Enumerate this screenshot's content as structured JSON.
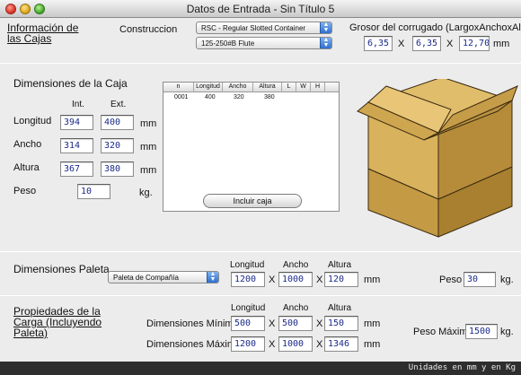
{
  "window": {
    "title": "Datos de Entrada - Sin Título 5"
  },
  "info": {
    "header_line1": "Información de",
    "header_line2": "las Cajas",
    "construction_label": "Construccion",
    "construction_value": "RSC - Regular Slotted Container",
    "flute_value": "125-250#B Flute",
    "thickness_label": "Grosor del corrugado (LargoxAnchoxAlto)",
    "thickness_values": [
      "6,35",
      "6,35",
      "12,70"
    ],
    "x_sep": "X",
    "unit_mm": "mm"
  },
  "dims": {
    "header": "Dimensiones de la Caja",
    "col_int": "Int.",
    "col_ext": "Ext.",
    "rows": [
      {
        "label": "Longitud",
        "int": "394",
        "ext": "400",
        "unit": "mm"
      },
      {
        "label": "Ancho",
        "int": "314",
        "ext": "320",
        "unit": "mm"
      },
      {
        "label": "Altura",
        "int": "367",
        "ext": "380",
        "unit": "mm"
      }
    ],
    "peso_label": "Peso",
    "peso_value": "10",
    "peso_unit": "kg.",
    "include_button": "Incluir caja"
  },
  "table": {
    "columns": [
      "n",
      "Longitud",
      "Ancho",
      "Altura",
      "L",
      "W",
      "H"
    ],
    "rows": [
      [
        "0001",
        "400",
        "320",
        "380",
        "",
        "",
        ""
      ]
    ]
  },
  "pallet": {
    "header": "Dimensiones Paleta",
    "pallet_select": "Paleta de Compañía",
    "col_longitud": "Longitud",
    "col_ancho": "Ancho",
    "col_altura": "Altura",
    "values": [
      "1200",
      "1000",
      "120"
    ],
    "unit_mm": "mm",
    "peso_label": "Peso",
    "peso_value": "30",
    "peso_unit": "kg."
  },
  "load": {
    "header_line1": "Propiedades de la",
    "header_line2": "Carga (Incluyendo",
    "header_line3": "Paleta)",
    "col_longitud": "Longitud",
    "col_ancho": "Ancho",
    "col_altura": "Altura",
    "min_label": "Dimensiones Mínimas",
    "min_values": [
      "500",
      "500",
      "150"
    ],
    "max_label": "Dimensiones Máximas",
    "max_values": [
      "1200",
      "1000",
      "1346"
    ],
    "unit_mm": "mm",
    "peso_max_label": "Peso Máximo",
    "peso_max_value": "1500",
    "peso_max_unit": "kg."
  },
  "status": {
    "text": "Unidades en mm y en Kg"
  },
  "colors": {
    "accent": "#2e6fd0",
    "box_light": "#d9b15a",
    "box_dark": "#a8802e",
    "input_text": "#1a2a8a"
  }
}
